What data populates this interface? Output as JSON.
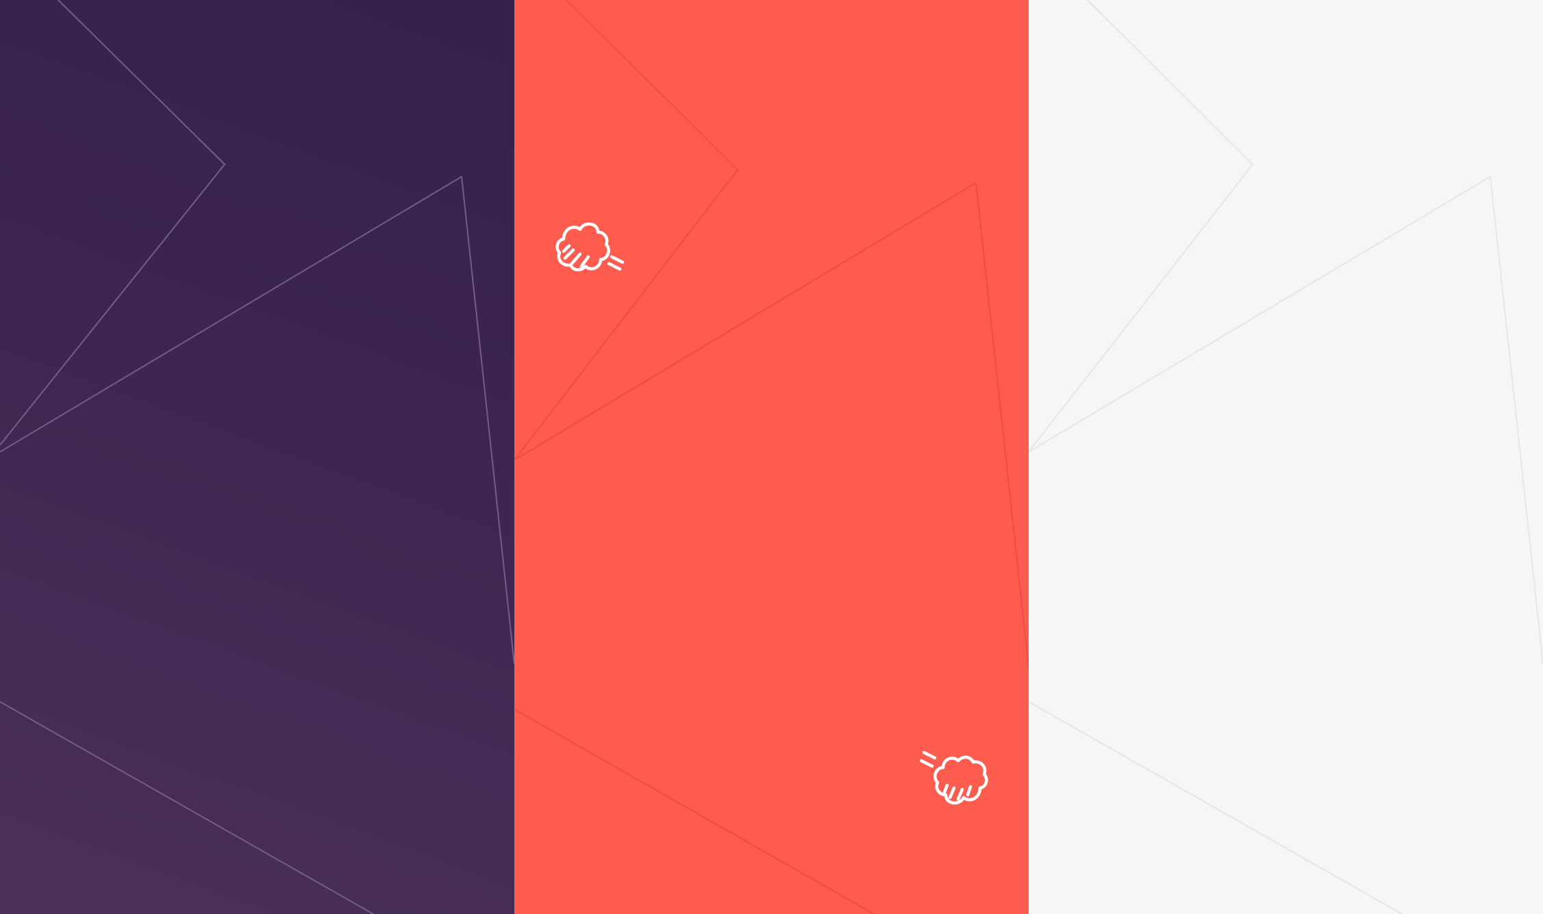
{
  "panels": [
    {
      "name": "purple-panel",
      "background": "#3d2650",
      "line_color": "#7d6693"
    },
    {
      "name": "coral-panel",
      "background": "#ff5c50",
      "line_color": "#f24a44"
    },
    {
      "name": "white-panel",
      "background": "#f6f6f6",
      "line_color": "#e6e6e6"
    }
  ],
  "icons": [
    "popcorn-cloud-icon",
    "popcorn-cloud-icon"
  ],
  "icon_color": "#ffffff"
}
